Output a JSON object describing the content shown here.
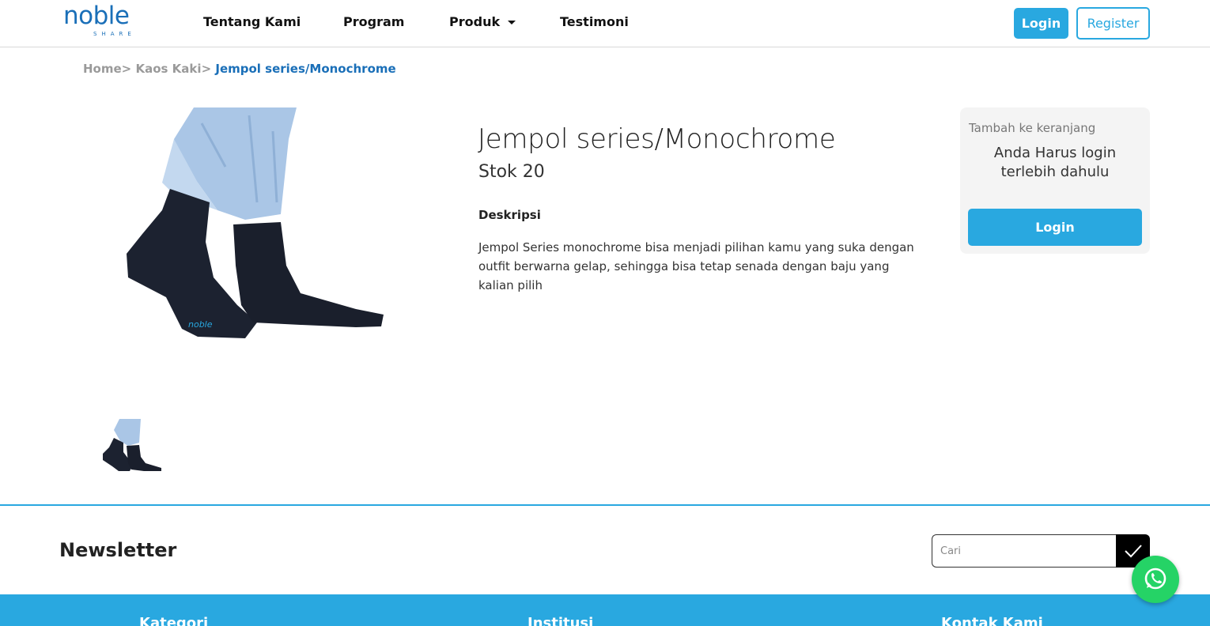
{
  "brand": {
    "name": "noble",
    "tagline": "SHARE",
    "color": "#1a6fb8",
    "accent": "#29a8e0"
  },
  "nav": {
    "items": [
      {
        "label": "Tentang Kami"
      },
      {
        "label": "Program"
      },
      {
        "label": "Produk",
        "has_dropdown": true
      },
      {
        "label": "Testimoni"
      }
    ],
    "login_label": "Login",
    "register_label": "Register"
  },
  "breadcrumb": {
    "items": [
      "Home",
      "Kaos Kaki"
    ],
    "separator": ">",
    "current": "Jempol series/Monochrome"
  },
  "product": {
    "title": "Jempol series/Monochrome",
    "stock": "Stok 20",
    "description_heading": "Deskripsi",
    "description": "Jempol Series monochrome bisa menjadi pilihan kamu yang suka dengan outfit berwarna gelap, sehingga bisa tetap senada dengan baju yang kalian pilih",
    "image_label": "noble"
  },
  "cart": {
    "title": "Tambah ke keranjang",
    "message": "Anda Harus login terlebih dahulu",
    "login_label": "Login"
  },
  "newsletter": {
    "title": "Newsletter",
    "placeholder": "Cari",
    "submit_icon": "check-icon"
  },
  "footer": {
    "columns": [
      "Kategori",
      "Institusi",
      "Kontak Kami"
    ]
  },
  "whatsapp": {
    "icon": "whatsapp-icon",
    "color": "#25d366"
  }
}
